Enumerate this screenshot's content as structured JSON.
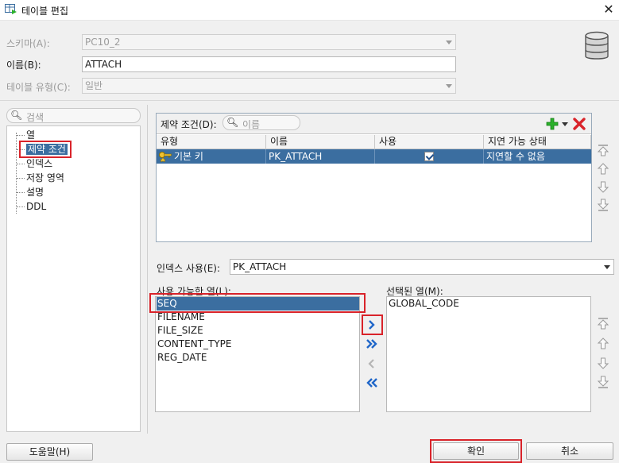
{
  "window": {
    "title": "테이블 편집",
    "close_glyph": "✕"
  },
  "form": {
    "schema_label": "스키마(A):",
    "schema_value": "PC10_2",
    "name_label": "이름(B):",
    "name_value": "ATTACH",
    "table_type_label": "테이블 유형(C):",
    "table_type_value": "일반"
  },
  "sidebar": {
    "search_placeholder": "검색",
    "items": [
      {
        "label": "열"
      },
      {
        "label": "제약 조건"
      },
      {
        "label": "인덱스"
      },
      {
        "label": "저장 영역"
      },
      {
        "label": "설명"
      },
      {
        "label": "DDL"
      }
    ]
  },
  "constraints": {
    "label": "제약 조건(D):",
    "search_placeholder": "이름",
    "columns": [
      "유형",
      "이름",
      "사용",
      "지연 가능 상태"
    ],
    "rows": [
      {
        "type": "기본 키",
        "name": "PK_ATTACH",
        "enabled": true,
        "deferrable": "지연할 수 없음"
      }
    ]
  },
  "index": {
    "label": "인덱스 사용(E):",
    "value": "PK_ATTACH"
  },
  "available_columns": {
    "label": "사용 가능한 열(L):",
    "items": [
      "SEQ",
      "FILENAME",
      "FILE_SIZE",
      "CONTENT_TYPE",
      "REG_DATE"
    ]
  },
  "selected_columns": {
    "label": "선택된 열(M):",
    "items": [
      "GLOBAL_CODE"
    ]
  },
  "buttons": {
    "help": "도움말(H)",
    "ok": "확인",
    "cancel": "취소"
  },
  "colors": {
    "selection": "#3b6ea0",
    "highlight_border": "#d9232a",
    "add_icon": "#2bb02b",
    "delete_icon": "#d9232a",
    "move_arrow": "#1f66c9"
  }
}
